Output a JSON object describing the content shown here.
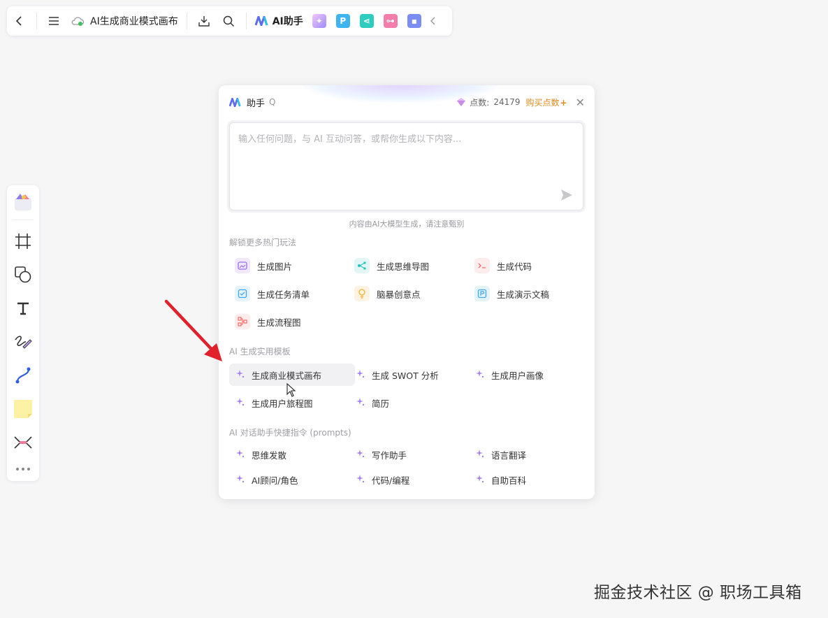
{
  "topbar": {
    "title": "AI生成商业模式画布",
    "ai_label": "AI助手",
    "app_icons": [
      "image-gen-app-icon",
      "slides-app-icon",
      "mindmap-app-icon",
      "flowchart-app-icon",
      "chat-app-icon"
    ]
  },
  "panel": {
    "title": "助手",
    "shortcut": "Q",
    "points_label": "点数:",
    "points_value": "24179",
    "buy_label": "购买点数",
    "input_placeholder": "输入任何问题，与 AI 互动问答，或帮你生成以下内容...",
    "disclaimer": "内容由AI大模型生成，请注意甄别",
    "section1": {
      "title": "解锁更多热门玩法",
      "items": [
        {
          "label": "生成图片",
          "icon": "image-icon",
          "color": "#9b6ee8"
        },
        {
          "label": "生成思维导图",
          "icon": "mindmap-icon",
          "color": "#28c3b8"
        },
        {
          "label": "生成代码",
          "icon": "code-icon",
          "color": "#f06a6a"
        },
        {
          "label": "生成任务清单",
          "icon": "checklist-icon",
          "color": "#3fa7f3"
        },
        {
          "label": "脑暴创意点",
          "icon": "lightbulb-icon",
          "color": "#f2b233"
        },
        {
          "label": "生成演示文稿",
          "icon": "presentation-icon",
          "color": "#3fa7f3"
        },
        {
          "label": "生成流程图",
          "icon": "flowchart-icon",
          "color": "#f06a6a"
        }
      ]
    },
    "section2": {
      "title": "AI 生成实用模板",
      "items": [
        "生成商业模式画布",
        "生成 SWOT 分析",
        "生成用户画像",
        "生成用户旅程图",
        "简历"
      ]
    },
    "section3": {
      "title": "AI 对话助手快捷指令 (prompts)",
      "items": [
        "思维发散",
        "写作助手",
        "语言翻译",
        "AI顾问/角色",
        "代码/编程",
        "自助百科"
      ]
    }
  },
  "watermark": "掘金技术社区 @ 职场工具箱"
}
